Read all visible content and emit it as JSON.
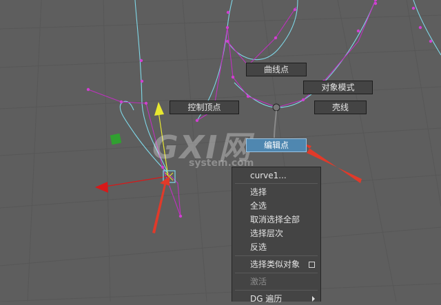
{
  "colors": {
    "viewport_bg": "#5e5e5e",
    "grid": "#575757",
    "curve_cyan": "#7fd8e8",
    "curve_magenta": "#c030c0",
    "cv_point": "#d040d0",
    "highlight": "#4f87b0",
    "annotation_arrow": "#e03a2a",
    "axis_x": "#d81818",
    "axis_y": "#e8e830",
    "handle_green": "#30a030"
  },
  "marking_menu": {
    "curve_point": "曲线点",
    "object_mode": "对象模式",
    "control_vertex": "控制顶点",
    "hull": "壳线",
    "edit_point": "编辑点"
  },
  "context_menu": {
    "header": "curve1...",
    "items": [
      {
        "label": "选择"
      },
      {
        "label": "全选"
      },
      {
        "label": "取消选择全部"
      },
      {
        "label": "选择层次"
      },
      {
        "label": "反选"
      },
      {
        "label": "选择类似对象",
        "checkbox": true
      },
      {
        "label": "激活",
        "disabled": true
      },
      {
        "label": "DG 遍历",
        "submenu": true
      }
    ]
  },
  "watermark": {
    "brand": "GXI网",
    "domain": "system.com"
  },
  "icons": [
    "move-manipulator-icon",
    "pivot-handle-icon",
    "submenu-arrow-icon",
    "option-box-icon",
    "annotation-arrow-icon"
  ]
}
